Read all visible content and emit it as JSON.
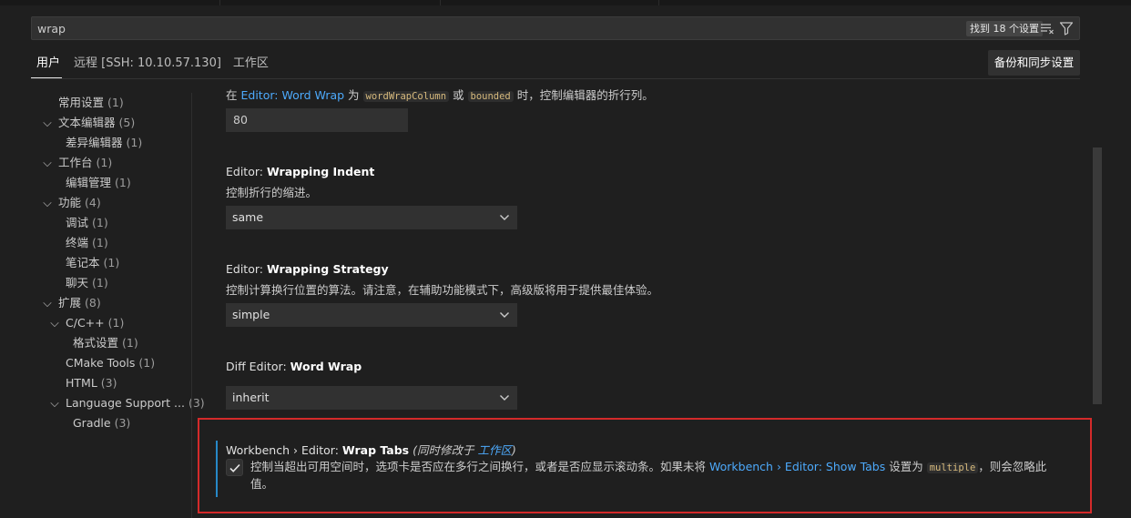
{
  "search": {
    "value": "wrap",
    "result_count": "找到 18 个设置"
  },
  "scopes": [
    {
      "label": "用户",
      "active": true
    },
    {
      "label": "远程 [SSH: 10.10.57.130]",
      "active": false
    },
    {
      "label": "工作区",
      "active": false
    }
  ],
  "sync_button": "备份和同步设置",
  "toc": {
    "common": {
      "label": "常用设置",
      "count": "(1)"
    },
    "text_editor": {
      "label": "文本编辑器",
      "count": "(5)"
    },
    "diff_editor": {
      "label": "差异编辑器",
      "count": "(1)"
    },
    "workbench": {
      "label": "工作台",
      "count": "(1)"
    },
    "editor_mgmt": {
      "label": "编辑管理",
      "count": "(1)"
    },
    "features": {
      "label": "功能",
      "count": "(4)"
    },
    "debug": {
      "label": "调试",
      "count": "(1)"
    },
    "terminal": {
      "label": "终端",
      "count": "(1)"
    },
    "notebook": {
      "label": "笔记本",
      "count": "(1)"
    },
    "chat": {
      "label": "聊天",
      "count": "(1)"
    },
    "extensions": {
      "label": "扩展",
      "count": "(8)"
    },
    "cpp": {
      "label": "C/C++",
      "count": "(1)"
    },
    "formatting": {
      "label": "格式设置",
      "count": "(1)"
    },
    "cmake": {
      "label": "CMake Tools",
      "count": "(1)"
    },
    "html": {
      "label": "HTML",
      "count": "(3)"
    },
    "lang_support": {
      "label": "Language Support ...",
      "count": "(3)"
    },
    "gradle": {
      "label": "Gradle",
      "count": "(3)"
    }
  },
  "settings": {
    "word_wrap_column": {
      "desc_pre": "在 ",
      "desc_link": "Editor: Word Wrap",
      "desc_mid": " 为 ",
      "code1": "wordWrapColumn",
      "desc_or": " 或 ",
      "code2": "bounded",
      "desc_post": " 时，控制编辑器的折行列。",
      "value": "80"
    },
    "wrapping_indent": {
      "category": "Editor: ",
      "name": "Wrapping Indent",
      "description": "控制折行的缩进。",
      "value": "same"
    },
    "wrapping_strategy": {
      "category": "Editor: ",
      "name": "Wrapping Strategy",
      "description": "控制计算换行位置的算法。请注意，在辅助功能模式下，高级版将用于提供最佳体验。",
      "value": "simple"
    },
    "diff_word_wrap": {
      "category": "Diff Editor: ",
      "name": "Word Wrap",
      "value": "inherit"
    },
    "wrap_tabs": {
      "category": "Workbench › Editor: ",
      "name": "Wrap Tabs",
      "modified_pre": "(同时修改于 ",
      "modified_link": "工作区",
      "modified_post": ")",
      "checked": true,
      "desc_pre": "控制当超出可用空间时，选项卡是否应在多行之间换行，或者是否应显示滚动条。如果未将 ",
      "desc_link": "Workbench › Editor: Show Tabs",
      "desc_mid": " 设置为 ",
      "desc_code": "multiple",
      "desc_post": "，则会忽略此值。"
    }
  },
  "colors": {
    "link": "#4daafc",
    "focus_border": "#2788c8",
    "highlight_box": "#d42a2a",
    "background": "#1f1f1f"
  },
  "icons": {
    "clear_filter": "clear-filters-icon",
    "filter": "filter-icon",
    "chevron": "chevron-down-icon",
    "check": "check-icon"
  }
}
